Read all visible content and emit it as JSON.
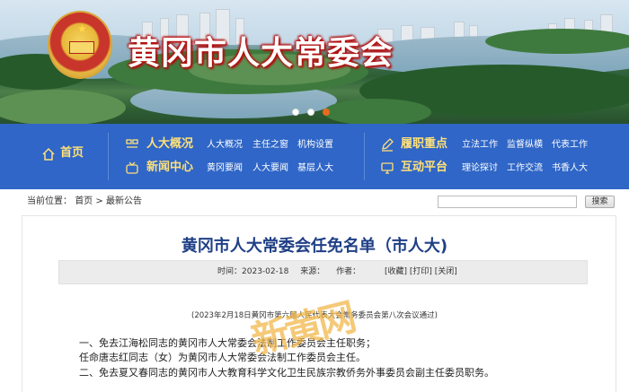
{
  "site": {
    "title": "黄冈市人大常委会",
    "emblem_icon": "national-emblem"
  },
  "banner": {
    "slides": 3,
    "active_slide": 3
  },
  "nav": {
    "home": "首页",
    "groups": [
      {
        "label": "人大概况",
        "icon": "grid-icon",
        "links": [
          "人大概况",
          "主任之窗",
          "机构设置"
        ]
      },
      {
        "label": "新闻中心",
        "icon": "tv-icon",
        "links": [
          "黄冈要闻",
          "人大要闻",
          "基层人大"
        ]
      },
      {
        "label": "履职重点",
        "icon": "pen-icon",
        "links": [
          "立法工作",
          "监督纵横",
          "代表工作"
        ]
      },
      {
        "label": "互动平台",
        "icon": "monitor-icon",
        "links": [
          "理论探讨",
          "工作交流",
          "书香人大"
        ]
      }
    ]
  },
  "breadcrumb": {
    "prefix": "当前位置：",
    "items": [
      "首页",
      "最新公告"
    ],
    "separator": ">"
  },
  "search": {
    "value": "",
    "button": "搜索"
  },
  "article": {
    "title": "黄冈市人大常委会任免名单（市人大)",
    "meta": {
      "time_label": "时间：",
      "time": "2023-02-18",
      "source_label": "来源：",
      "author_label": "作者：",
      "actions": [
        "[收藏]",
        "[打印]",
        "[关闭]"
      ]
    },
    "subtitle": "(2023年2月18日黄冈市第六届人民代表大会常务委员会第八次会议通过)",
    "paragraphs": [
      "一、免去江海松同志的黄冈市人大常委会法制工作委员会主任职务；",
      "任命唐志红同志（女）为黄冈市人大常委会法制工作委员会主任。",
      "二、免去夏又春同志的黄冈市人大教育科学文化卫生民族宗教侨务外事委员会副主任委员职务。"
    ]
  },
  "watermark": "新黄网",
  "colors": {
    "nav_bg": "#2f66c7",
    "nav_category": "#ffe07a",
    "title_blue": "#1f3f86",
    "accent_orange": "#e96a1d"
  }
}
